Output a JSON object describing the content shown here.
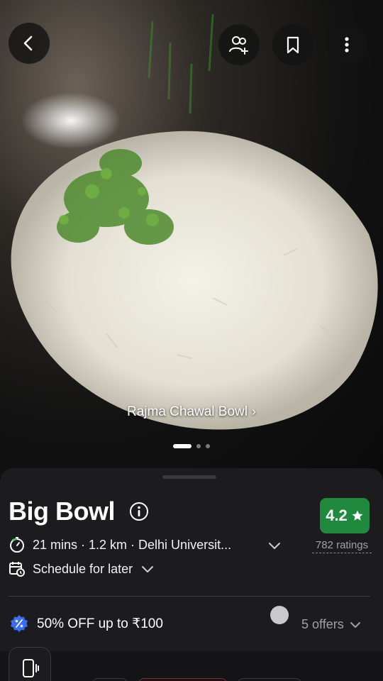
{
  "hero": {
    "dish_caption": "Rajma Chawal Bowl",
    "caption_chevron": "›",
    "carousel_pages": 3,
    "carousel_active_index": 0
  },
  "top_bar": {
    "back_icon": "chevron-left-icon",
    "actions": [
      "add-friends-icon",
      "bookmark-icon",
      "more-vertical-icon"
    ]
  },
  "restaurant": {
    "name": "Big Bowl",
    "rating": "4.2",
    "ratings_count": "782 ratings",
    "delivery_info": "21 mins · 1.2 km · Delhi Universit...",
    "schedule_label": "Schedule for later"
  },
  "offer": {
    "text": "50% OFF up to ₹100",
    "offers_count": "5 offers"
  },
  "colors": {
    "rating_green": "#1f8a3e",
    "sheet_bg": "#1c1c1e",
    "offer_badge_blue": "#3b6cf5"
  }
}
